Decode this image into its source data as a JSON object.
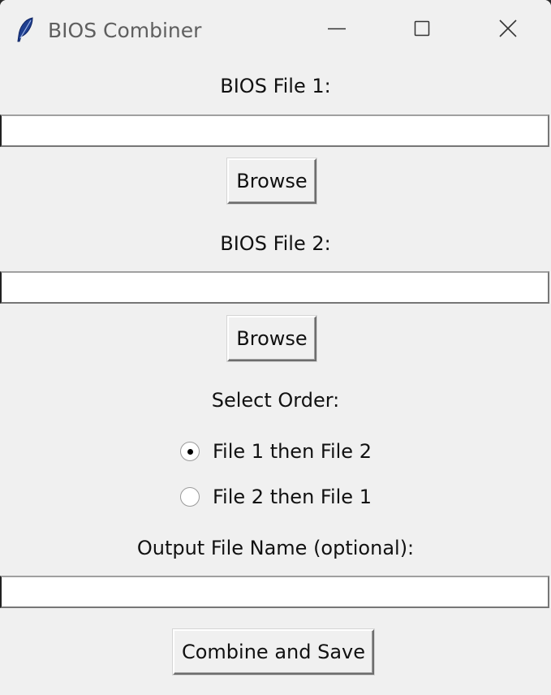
{
  "window": {
    "title": "BIOS Combiner",
    "icon": "feather-icon"
  },
  "form": {
    "file1_label": "BIOS File 1:",
    "file1_value": "",
    "file1_browse": "Browse",
    "file2_label": "BIOS File 2:",
    "file2_value": "",
    "file2_browse": "Browse",
    "order_label": "Select Order:",
    "order_options": [
      {
        "label": "File 1 then File 2",
        "selected": true
      },
      {
        "label": "File 2 then File 1",
        "selected": false
      }
    ],
    "output_label": "Output File Name (optional):",
    "output_value": "",
    "combine_button": "Combine and Save"
  }
}
